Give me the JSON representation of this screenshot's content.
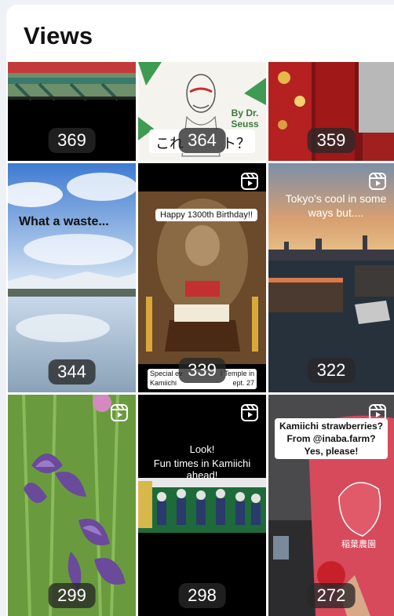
{
  "header": {
    "title": "Views"
  },
  "row1": [
    {
      "count": "369",
      "overlay": ""
    },
    {
      "count": "364",
      "overlay": "これ",
      "overlay2": "ト？",
      "book_text": "By Dr. Seuss"
    },
    {
      "count": "359",
      "overlay": ""
    }
  ],
  "row2": [
    {
      "count": "344",
      "overlay": "What a waste..."
    },
    {
      "count": "339",
      "overlay": "Happy 1300th Birthday!!",
      "caption1": "Special ev",
      "caption2": "l Temple in",
      "caption3": "Kamiichi",
      "caption4": "ept. 27"
    },
    {
      "count": "322",
      "overlay": "Tokyo's cool in some ways but...."
    }
  ],
  "row3": [
    {
      "count": "299",
      "overlay": ""
    },
    {
      "count": "298",
      "overlay1": "Look!",
      "overlay2": "Fun times in Kamiichi ahead!"
    },
    {
      "count": "272",
      "overlay1": "Kamiichi strawberries?",
      "overlay2": "From @inaba.farm?",
      "overlay3": "Yes, please!",
      "bag_text": "稲葉農園"
    }
  ],
  "icons": {
    "reel": "reel-icon"
  }
}
